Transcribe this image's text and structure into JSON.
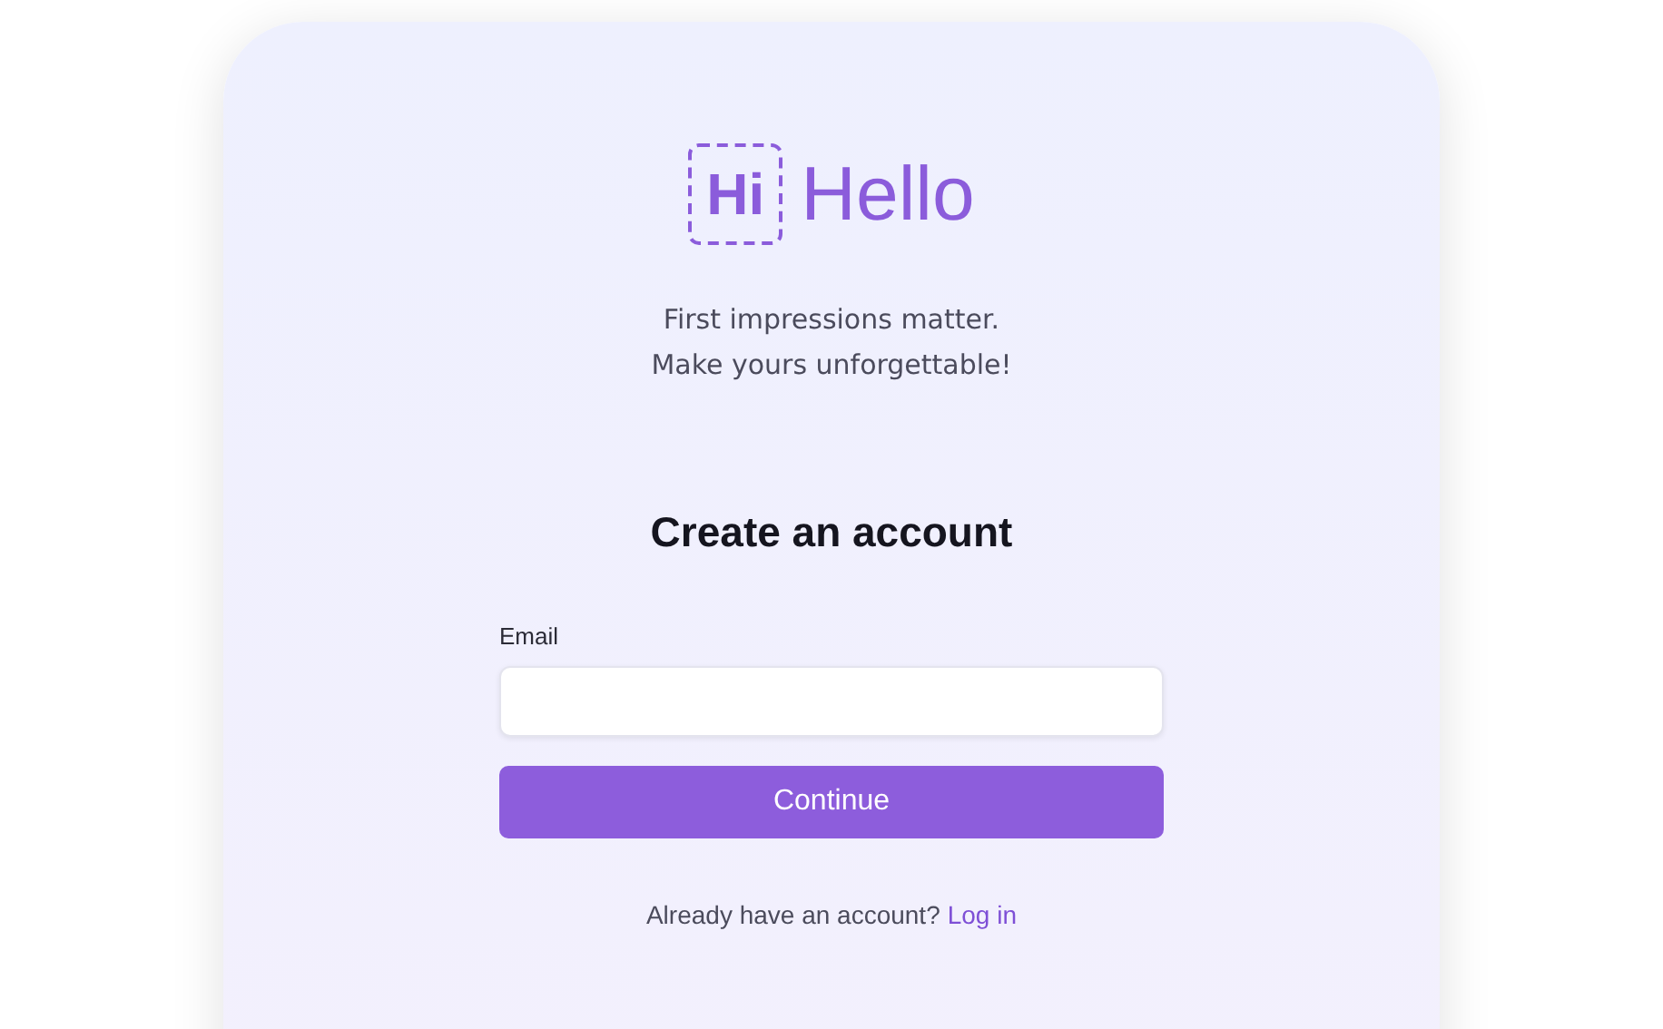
{
  "logo": {
    "mark": "Hi",
    "name": "Hello"
  },
  "tagline": [
    "First impressions matter.",
    "Make yours unforgettable!"
  ],
  "heading": "Create an account",
  "email_field": {
    "label": "Email"
  },
  "primary_button": "Continue",
  "footer": {
    "text": "Already have an account?",
    "link": "Log in"
  }
}
